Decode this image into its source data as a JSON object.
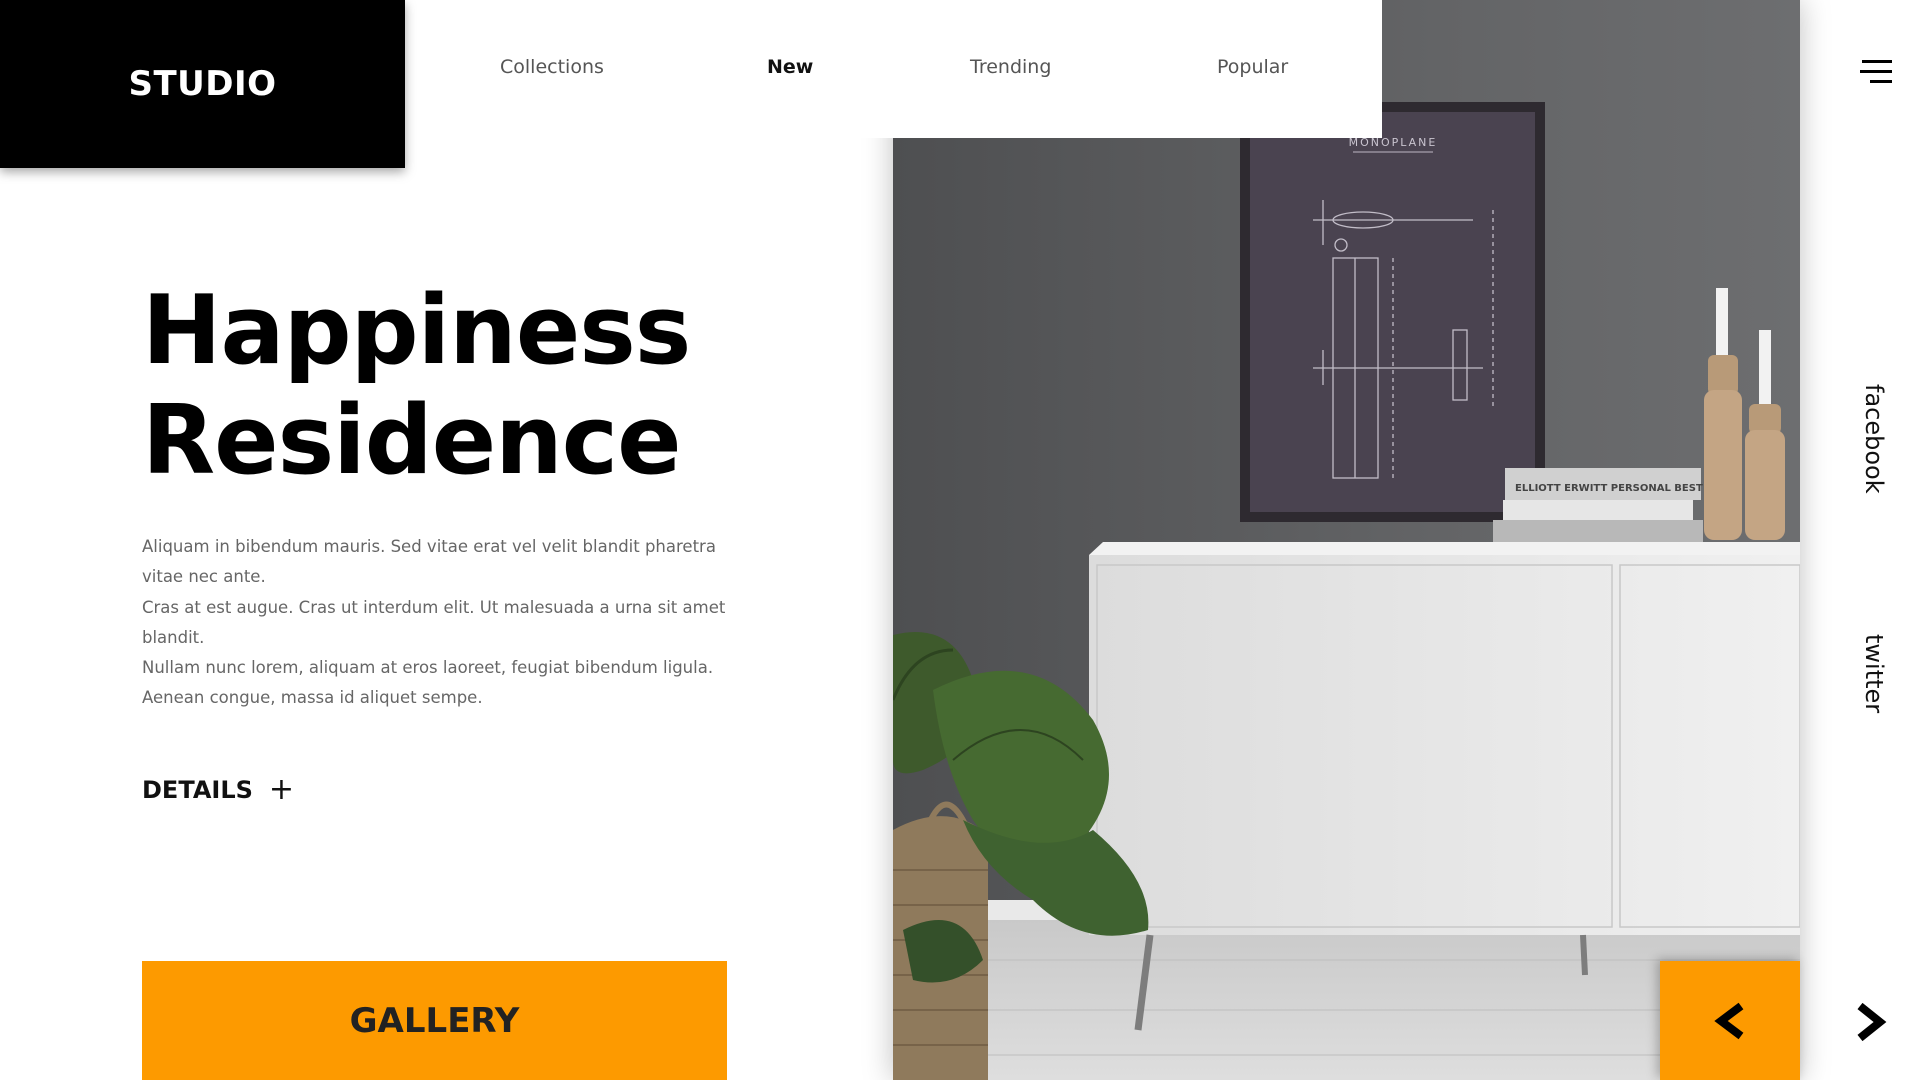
{
  "brand": {
    "logo_text": "STUDIO"
  },
  "nav": {
    "items": [
      {
        "label": "Collections",
        "active": false
      },
      {
        "label": "New",
        "active": true
      },
      {
        "label": "Trending",
        "active": false
      },
      {
        "label": "Popular",
        "active": false
      }
    ]
  },
  "hero": {
    "title_line1": "Happiness",
    "title_line2": "Residence",
    "description": [
      "Aliquam in bibendum mauris. Sed vitae erat vel velit blandit pharetra vitae nec ante.",
      "Cras at est augue. Cras ut interdum elit. Ut malesuada a urna sit amet blandit.",
      "Nullam nunc lorem, aliquam at eros laoreet, feugiat bibendum ligula.",
      "Aenean congue, massa id aliquet sempe."
    ],
    "details_label": "DETAILS",
    "details_icon": "+"
  },
  "gallery_button": {
    "label": "GALLERY"
  },
  "social": {
    "facebook": "facebook",
    "twitter": "twitter"
  },
  "photo": {
    "poster_title": "MONOPLANE",
    "book_title": "ELLIOTT ERWITT PERSONAL BEST"
  },
  "icons": {
    "menu": "hamburger-menu-icon",
    "prev": "chevron-left-icon",
    "next": "chevron-right-icon"
  },
  "colors": {
    "accent": "#fd9a00",
    "logo_bg": "#000000",
    "text_dark": "#111111",
    "text_muted": "#666666",
    "wall": "#5b5c5e"
  }
}
